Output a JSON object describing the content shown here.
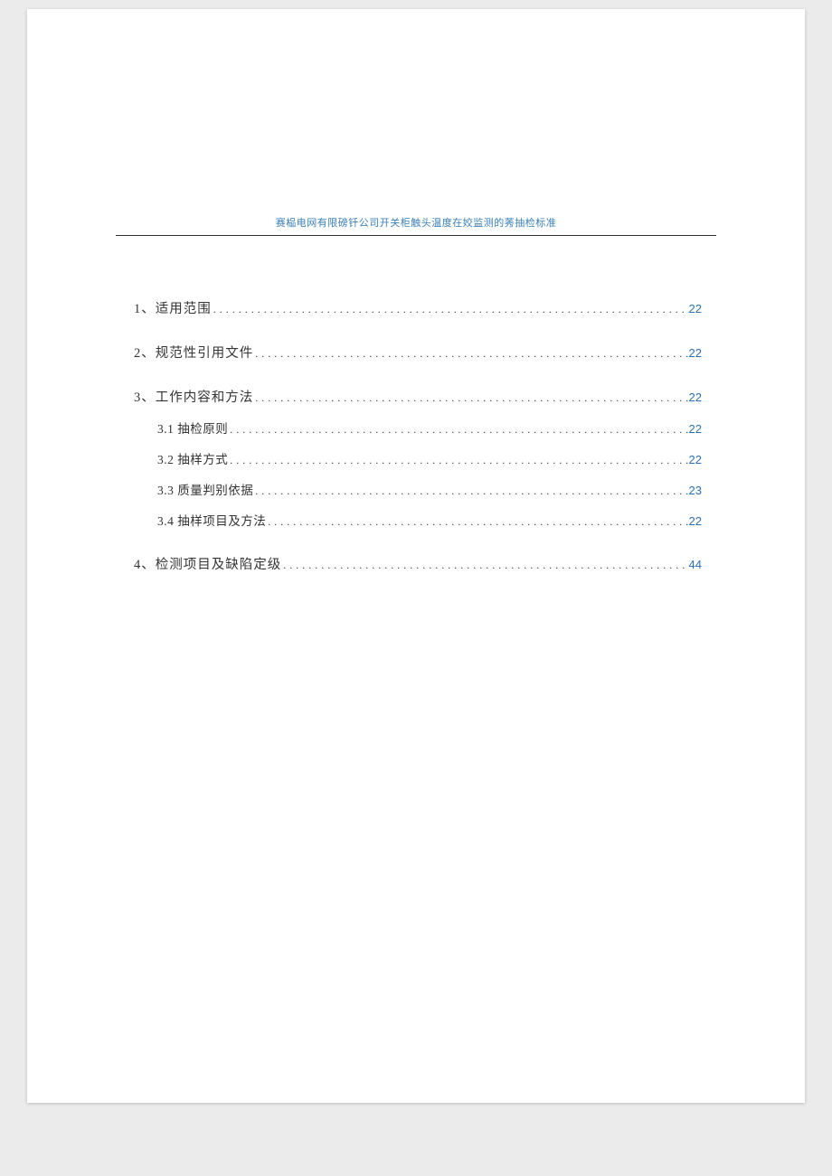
{
  "header": {
    "title": "赛榀电网有限磅钎公司开关柜触头温度在姣监测的莠抽检标准"
  },
  "toc": [
    {
      "level": 1,
      "label": "1、适用范围",
      "page": "22"
    },
    {
      "level": 1,
      "label": "2、规范性引用文件",
      "page": "22"
    },
    {
      "level": 1,
      "label": "3、工作内容和方法",
      "page": "22"
    },
    {
      "level": 2,
      "label": "3.1 抽检原则",
      "page": "22"
    },
    {
      "level": 2,
      "label": "3.2 抽样方式",
      "page": "22"
    },
    {
      "level": 2,
      "label": "3.3 质量判别依据",
      "page": "23"
    },
    {
      "level": 2,
      "label": "3.4 抽样项目及方法",
      "page": "22"
    },
    {
      "level": 1,
      "label": "4、检测项目及缺陷定级",
      "page": "44"
    }
  ]
}
